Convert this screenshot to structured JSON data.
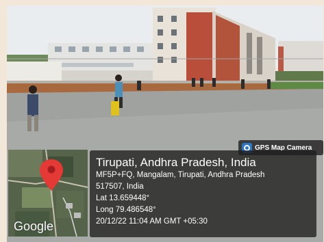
{
  "badge": {
    "label": "GPS Map Camera",
    "icon": "camera-pin-icon"
  },
  "map": {
    "logo": "Google",
    "marker_icon": "map-pin-icon",
    "marker_color": "#e53935"
  },
  "location": {
    "title": "Tirupati, Andhra Pradesh, India",
    "address_line1": "MF5P+FQ, Mangalam, Tirupati, Andhra Pradesh",
    "address_line2": "517507, India",
    "latitude": "Lat 13.659448°",
    "longitude": "Long 79.486548°",
    "datetime": "20/12/22 11:04 AM GMT +05:30"
  }
}
